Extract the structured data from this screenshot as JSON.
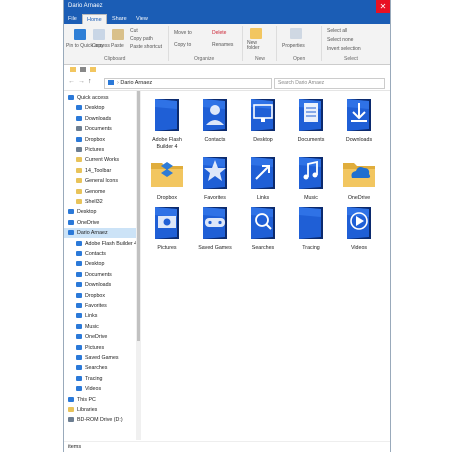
{
  "window": {
    "title": "Dario Arnaez",
    "close_glyph": "✕"
  },
  "tabs": [
    {
      "label": "File"
    },
    {
      "label": "Home"
    },
    {
      "label": "Share"
    },
    {
      "label": "View"
    }
  ],
  "ribbon": {
    "clipboard": {
      "pin_label": "Pin to Quick access",
      "copy": "Copy",
      "paste": "Paste",
      "cut": "Cut",
      "copy_path": "Copy path",
      "paste_shortcut": "Paste shortcut",
      "group": "Clipboard"
    },
    "organize": {
      "move_to": "Move to",
      "copy_to": "Copy to",
      "delete": "Delete",
      "rename": "Renames",
      "group": "Organize"
    },
    "new": {
      "new_folder": "New folder",
      "group": "New"
    },
    "open": {
      "properties": "Properties",
      "group": "Open"
    },
    "select": {
      "select_all": "Select all",
      "select_none": "Select none",
      "invert": "Invert selection",
      "group": "Select"
    }
  },
  "address": {
    "path": "Dario Arnaez",
    "search_placeholder": "Search Dario Arnaez"
  },
  "nav_items": [
    {
      "label": "Quick access",
      "color": "#2b79d8",
      "pinned": false
    },
    {
      "label": "Desktop",
      "color": "#2b79d8",
      "pinned": true
    },
    {
      "label": "Downloads",
      "color": "#2b79d8",
      "pinned": true
    },
    {
      "label": "Documents",
      "color": "#6d7e91",
      "pinned": true
    },
    {
      "label": "Dropbox",
      "color": "#2b79d8",
      "pinned": true
    },
    {
      "label": "Pictures",
      "color": "#6d7e91",
      "pinned": true
    },
    {
      "label": "Current Works",
      "color": "#e8c35a",
      "pinned": true
    },
    {
      "label": "14_Toolbar",
      "color": "#e8c35a",
      "pinned": false
    },
    {
      "label": "General Icons",
      "color": "#e8c35a",
      "pinned": false
    },
    {
      "label": "Genome",
      "color": "#e8c35a",
      "pinned": false
    },
    {
      "label": "Shell32",
      "color": "#e8c35a",
      "pinned": false
    },
    {
      "label": "Desktop",
      "color": "#2b79d8",
      "pinned": false
    },
    {
      "label": "OneDrive",
      "color": "#2b79d8",
      "pinned": false
    },
    {
      "label": "Dario Arnaez",
      "color": "#2b79d8",
      "pinned": false,
      "selected": true
    },
    {
      "label": "Adobe Flash Builder 4",
      "color": "#2b79d8",
      "pinned": false
    },
    {
      "label": "Contacts",
      "color": "#2b79d8",
      "pinned": false
    },
    {
      "label": "Desktop",
      "color": "#2b79d8",
      "pinned": false
    },
    {
      "label": "Documents",
      "color": "#2b79d8",
      "pinned": false
    },
    {
      "label": "Downloads",
      "color": "#2b79d8",
      "pinned": false
    },
    {
      "label": "Dropbox",
      "color": "#2b79d8",
      "pinned": false
    },
    {
      "label": "Favorites",
      "color": "#2b79d8",
      "pinned": false
    },
    {
      "label": "Links",
      "color": "#2b79d8",
      "pinned": false
    },
    {
      "label": "Music",
      "color": "#2b79d8",
      "pinned": false
    },
    {
      "label": "OneDrive",
      "color": "#2b79d8",
      "pinned": false
    },
    {
      "label": "Pictures",
      "color": "#2b79d8",
      "pinned": false
    },
    {
      "label": "Saved Games",
      "color": "#2b79d8",
      "pinned": false
    },
    {
      "label": "Searches",
      "color": "#2b79d8",
      "pinned": false
    },
    {
      "label": "Tracing",
      "color": "#2b79d8",
      "pinned": false
    },
    {
      "label": "Videos",
      "color": "#2b79d8",
      "pinned": false
    },
    {
      "label": "This PC",
      "color": "#2b79d8",
      "pinned": false
    },
    {
      "label": "Libraries",
      "color": "#e8c35a",
      "pinned": false
    },
    {
      "label": "BD-ROM Drive (D:)",
      "color": "#6d7e91",
      "pinned": false
    }
  ],
  "folders": [
    {
      "label": "Adobe Flash Builder 4",
      "icon": "blank-document-icon",
      "kind": "blue"
    },
    {
      "label": "Contacts",
      "icon": "person-icon",
      "kind": "blue"
    },
    {
      "label": "Desktop",
      "icon": "monitor-icon",
      "kind": "blue"
    },
    {
      "label": "Documents",
      "icon": "document-icon",
      "kind": "blue"
    },
    {
      "label": "Downloads",
      "icon": "download-arrow-icon",
      "kind": "blue"
    },
    {
      "label": "Dropbox",
      "icon": "dropbox-icon",
      "kind": "yellow"
    },
    {
      "label": "Favorites",
      "icon": "star-icon",
      "kind": "blue"
    },
    {
      "label": "Links",
      "icon": "link-arrow-icon",
      "kind": "blue"
    },
    {
      "label": "Music",
      "icon": "music-note-icon",
      "kind": "blue"
    },
    {
      "label": "OneDrive",
      "icon": "cloud-icon",
      "kind": "yellow"
    },
    {
      "label": "Pictures",
      "icon": "camera-icon",
      "kind": "blue"
    },
    {
      "label": "Saved Games",
      "icon": "gamepad-icon",
      "kind": "blue"
    },
    {
      "label": "Searches",
      "icon": "magnifier-icon",
      "kind": "blue"
    },
    {
      "label": "Tracing",
      "icon": "blank-document-icon",
      "kind": "blue"
    },
    {
      "label": "Videos",
      "icon": "play-icon",
      "kind": "blue"
    }
  ],
  "status": {
    "text": "items"
  },
  "colors": {
    "accent": "#1b5db5",
    "folder_blue": "#1f5fd6",
    "folder_dark": "#0b2a6e",
    "folder_yellow": "#f2c660",
    "selection": "#cce3f7"
  }
}
